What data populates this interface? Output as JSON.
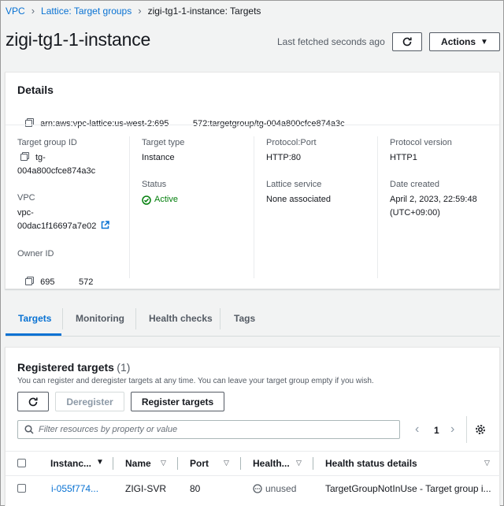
{
  "breadcrumb": {
    "items": [
      "VPC",
      "Lattice: Target groups"
    ],
    "current": "zigi-tg1-1-instance: Targets"
  },
  "page": {
    "title": "zigi-tg1-1-instance",
    "fetched": "Last fetched seconds ago",
    "actions_label": "Actions"
  },
  "details": {
    "heading": "Details",
    "arn": "arn:aws:vpc-lattice:us-west-2:695          572:targetgroup/tg-004a800cfce874a3c",
    "target_group_id_label": "Target group ID",
    "target_group_id_line1": "tg-",
    "target_group_id_line2": "004a800cfce874a3c",
    "vpc_label": "VPC",
    "vpc_line1": "vpc-",
    "vpc_line2": "00dac1f16697a7e02",
    "owner_id_label": "Owner ID",
    "owner_id": "695          572",
    "target_type_label": "Target type",
    "target_type": "Instance",
    "status_label": "Status",
    "status": "Active",
    "protocol_port_label": "Protocol:Port",
    "protocol_port": "HTTP:80",
    "lattice_service_label": "Lattice service",
    "lattice_service": "None associated",
    "protocol_version_label": "Protocol version",
    "protocol_version": "HTTP1",
    "date_created_label": "Date created",
    "date_created_line1": "April 2, 2023, 22:59:48",
    "date_created_line2": "(UTC+09:00)"
  },
  "tabs": [
    "Targets",
    "Monitoring",
    "Health checks",
    "Tags"
  ],
  "targets": {
    "heading": "Registered targets",
    "count": "(1)",
    "description": "You can register and deregister targets at any time. You can leave your target group empty if you wish.",
    "deregister_label": "Deregister",
    "register_label": "Register targets",
    "filter_placeholder": "Filter resources by property or value",
    "page_number": "1",
    "columns": [
      "Instanc...",
      "Name",
      "Port",
      "Health...",
      "Health status details"
    ],
    "rows": [
      {
        "instance": "i-055f774...",
        "name": "ZIGI-SVR",
        "port": "80",
        "health": "unused",
        "details": "TargetGroupNotInUse - Target group i..."
      }
    ]
  },
  "colors": {
    "link": "#0972d3",
    "success": "#037f0c",
    "text": "#16191f",
    "muted": "#545b64"
  }
}
